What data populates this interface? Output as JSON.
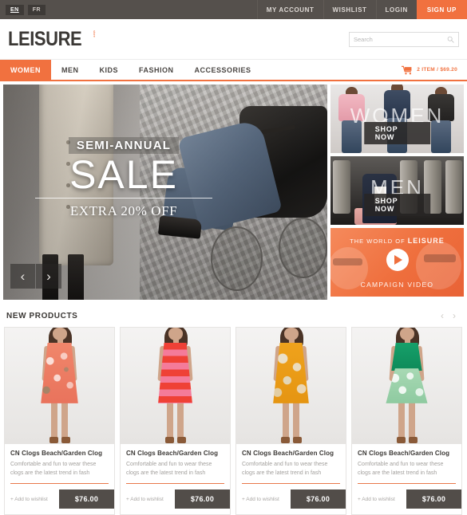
{
  "topbar": {
    "languages": [
      {
        "code": "EN",
        "active": true
      },
      {
        "code": "FR",
        "active": false
      }
    ],
    "links": [
      "MY ACCOUNT",
      "WISHLIST",
      "LOGIN"
    ],
    "signup": "SIGN UP"
  },
  "brand": {
    "name": "LEISURE",
    "tagline": "store"
  },
  "search": {
    "placeholder": "Search",
    "value": "",
    "icon": "search-icon"
  },
  "nav": {
    "items": [
      "WOMEN",
      "MEN",
      "KIDS",
      "FASHION",
      "ACCESSORIES"
    ],
    "active_index": 0,
    "cart": {
      "icon": "shopping-cart-icon",
      "summary": "2 ITEM / $69.20"
    }
  },
  "hero": {
    "kicker": "SEMI-ANNUAL",
    "title": "SALE",
    "subtitle": "EXTRA 20% OFF",
    "prev": "‹",
    "next": "›"
  },
  "promos": [
    {
      "label": "WOMEN",
      "button": "SHOP NOW",
      "kind": "women"
    },
    {
      "label": "MEN",
      "button": "SHOP NOW",
      "kind": "men"
    }
  ],
  "video_promo": {
    "top_prefix": "THE WORLD OF ",
    "top_brand": "LEISURE",
    "bottom": "CAMPAIGN VIDEO",
    "play_icon": "play-icon",
    "accent": "#ef6f3d"
  },
  "section": {
    "title": "NEW PRODUCTS",
    "prev": "‹",
    "next": "›"
  },
  "products": [
    {
      "title": "CN Clogs Beach/Garden Clog",
      "description": "Comfortable and fun to wear these clogs are the latest trend in fash",
      "wishlist": "+ Add to wishlist",
      "price": "$76.00",
      "swatch": "dress-a"
    },
    {
      "title": "CN Clogs Beach/Garden Clog",
      "description": "Comfortable and fun to wear these clogs are the latest trend in fash",
      "wishlist": "+ Add to wishlist",
      "price": "$76.00",
      "swatch": "dress-b"
    },
    {
      "title": "CN Clogs Beach/Garden Clog",
      "description": "Comfortable and fun to wear these clogs are the latest trend in fash",
      "wishlist": "+ Add to wishlist",
      "price": "$76.00",
      "swatch": "dress-c"
    },
    {
      "title": "CN Clogs Beach/Garden Clog",
      "description": "Comfortable and fun to wear these clogs are the latest trend in fash",
      "wishlist": "+ Add to wishlist",
      "price": "$76.00",
      "swatch": "dress-d"
    }
  ],
  "colors": {
    "accent": "#f1713f",
    "dark": "#55504c",
    "price_button": "#524d49"
  }
}
